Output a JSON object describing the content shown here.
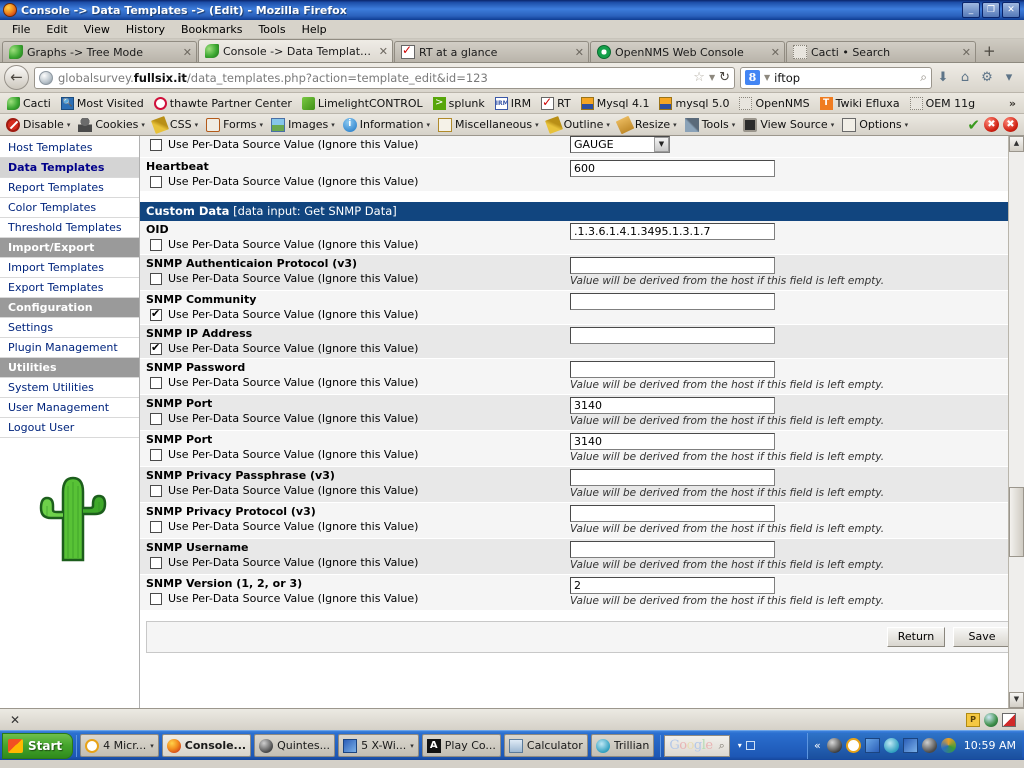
{
  "window": {
    "title": "Console -> Data Templates -> (Edit) - Mozilla Firefox",
    "app_icon": "firefox-icon",
    "minimize_label": "_",
    "maximize_label": "❐",
    "close_label": "✕"
  },
  "menubar": {
    "items": [
      {
        "label": "File"
      },
      {
        "label": "Edit"
      },
      {
        "label": "View"
      },
      {
        "label": "History"
      },
      {
        "label": "Bookmarks"
      },
      {
        "label": "Tools"
      },
      {
        "label": "Help"
      }
    ]
  },
  "tabs": {
    "items": [
      {
        "label": "Graphs -> Tree Mode",
        "icon": "firefox-leaf-icon",
        "active": false,
        "close": "✕"
      },
      {
        "label": "Console -> Data Templates -> ...",
        "icon": "firefox-leaf-icon",
        "active": true,
        "close": "✕"
      },
      {
        "label": "RT at a glance",
        "icon": "rt-check-icon",
        "active": false,
        "close": "✕"
      },
      {
        "label": "OpenNMS Web Console",
        "icon": "opennms-icon",
        "active": false,
        "close": "✕"
      },
      {
        "label": "Cacti • Search",
        "icon": "blank-page-icon",
        "active": false,
        "close": "✕"
      }
    ],
    "new_tab_label": "+"
  },
  "navbar": {
    "back_label": "←",
    "url_prefix": "globalsurvey.",
    "url_domain": "fullsix.it",
    "url_suffix": "/data_templates.php?action=template_edit&id=123",
    "star_label": "☆",
    "dropdown_label": "▼",
    "reload_label": "↻",
    "search_engine": "8",
    "search_query": "iftop",
    "magnifier_label": "⌕",
    "download_label": "⬇",
    "home_label": "⌂",
    "extra_label": "⚙",
    "overflow_label": "▾"
  },
  "bookmarks": {
    "items": [
      {
        "label": "Cacti",
        "icon": "cacti-icon"
      },
      {
        "label": "Most Visited",
        "icon": "most-visited-icon"
      },
      {
        "label": "thawte Partner Center",
        "icon": "thawte-icon"
      },
      {
        "label": "LimelightCONTROL",
        "icon": "limelight-icon"
      },
      {
        "label": "splunk",
        "icon": "splunk-icon"
      },
      {
        "label": "IRM",
        "icon": "irm-icon"
      },
      {
        "label": "RT",
        "icon": "rt-check-icon"
      },
      {
        "label": "Mysql 4.1",
        "icon": "phpmyadmin-icon"
      },
      {
        "label": "mysql 5.0",
        "icon": "phpmyadmin-icon"
      },
      {
        "label": "OpenNMS",
        "icon": "blank-page-icon"
      },
      {
        "label": "Twiki Efluxa",
        "icon": "twiki-icon"
      },
      {
        "label": "OEM 11g",
        "icon": "blank-page-icon"
      }
    ],
    "overflow_label": "»"
  },
  "devtoolbar": {
    "items": [
      {
        "label": "Disable",
        "icon": "disable-icon",
        "caret": "▾"
      },
      {
        "label": "Cookies",
        "icon": "cookies-icon",
        "caret": "▾"
      },
      {
        "label": "CSS",
        "icon": "css-icon",
        "caret": "▾"
      },
      {
        "label": "Forms",
        "icon": "forms-icon",
        "caret": "▾"
      },
      {
        "label": "Images",
        "icon": "images-icon",
        "caret": "▾"
      },
      {
        "label": "Information",
        "icon": "information-icon",
        "caret": "▾"
      },
      {
        "label": "Miscellaneous",
        "icon": "miscellaneous-icon",
        "caret": "▾"
      },
      {
        "label": "Outline",
        "icon": "outline-icon",
        "caret": "▾"
      },
      {
        "label": "Resize",
        "icon": "resize-icon",
        "caret": "▾"
      },
      {
        "label": "Tools",
        "icon": "tools-icon",
        "caret": "▾"
      },
      {
        "label": "View Source",
        "icon": "view-source-icon",
        "caret": "▾"
      },
      {
        "label": "Options",
        "icon": "options-icon",
        "caret": "▾"
      }
    ],
    "validation_ok": "✔",
    "error_badge_1": "✖",
    "error_badge_2": "✖"
  },
  "sidebar": {
    "items": [
      {
        "label": "Host Templates",
        "type": "link",
        "selected": false
      },
      {
        "label": "Data Templates",
        "type": "link",
        "selected": true
      },
      {
        "label": "Report Templates",
        "type": "link",
        "selected": false
      },
      {
        "label": "Color Templates",
        "type": "link",
        "selected": false
      },
      {
        "label": "Threshold Templates",
        "type": "link",
        "selected": false
      },
      {
        "label": "Import/Export",
        "type": "header",
        "selected": false
      },
      {
        "label": "Import Templates",
        "type": "link",
        "selected": false
      },
      {
        "label": "Export Templates",
        "type": "link",
        "selected": false
      },
      {
        "label": "Configuration",
        "type": "header",
        "selected": false
      },
      {
        "label": "Settings",
        "type": "link",
        "selected": false
      },
      {
        "label": "Plugin Management",
        "type": "link",
        "selected": false
      },
      {
        "label": "Utilities",
        "type": "header",
        "selected": false
      },
      {
        "label": "System Utilities",
        "type": "link",
        "selected": false
      },
      {
        "label": "User Management",
        "type": "link",
        "selected": false
      },
      {
        "label": "Logout User",
        "type": "link",
        "selected": false
      }
    ],
    "logo_alt": "cactus-logo"
  },
  "form": {
    "per_data_label": "Use Per-Data Source Value (Ignore this Value)",
    "derived_hint": "Value will be derived from the host if this field is left empty.",
    "partial_top_row": {
      "checkbox_checked": false,
      "select_value": "GAUGE"
    },
    "heartbeat_row": {
      "label": "Heartbeat",
      "checkbox_checked": false,
      "value": "600"
    },
    "section_header": {
      "title": "Custom Data",
      "subtitle": "[data input: Get SNMP Data]"
    },
    "fields": [
      {
        "label": "OID",
        "checked": false,
        "value": ".1.3.6.1.4.1.3495.1.3.1.7",
        "hint": false,
        "shade": false
      },
      {
        "label": "SNMP Authenticaion Protocol (v3)",
        "checked": false,
        "value": "",
        "hint": true,
        "shade": true
      },
      {
        "label": "SNMP Community",
        "checked": true,
        "value": "",
        "hint": false,
        "shade": false
      },
      {
        "label": "SNMP IP Address",
        "checked": true,
        "value": "",
        "hint": false,
        "shade": true
      },
      {
        "label": "SNMP Password",
        "checked": false,
        "value": "",
        "hint": true,
        "shade": false
      },
      {
        "label": "SNMP Port",
        "checked": false,
        "value": "3140",
        "hint": true,
        "shade": true
      },
      {
        "label": "SNMP Port",
        "checked": false,
        "value": "3140",
        "hint": true,
        "shade": false
      },
      {
        "label": "SNMP Privacy Passphrase (v3)",
        "checked": false,
        "value": "",
        "hint": true,
        "shade": true
      },
      {
        "label": "SNMP Privacy Protocol (v3)",
        "checked": false,
        "value": "",
        "hint": true,
        "shade": false
      },
      {
        "label": "SNMP Username",
        "checked": false,
        "value": "",
        "hint": true,
        "shade": true
      },
      {
        "label": "SNMP Version (1, 2, or 3)",
        "checked": false,
        "value": "2",
        "hint": true,
        "shade": false
      }
    ],
    "buttons": {
      "return_label": "Return",
      "save_label": "Save"
    }
  },
  "scrollbar": {
    "up_label": "▲",
    "down_label": "▼"
  },
  "statusbar": {
    "close_label": "✕",
    "icons": [
      "p-badge-icon",
      "globe-icon",
      "flag-icon"
    ]
  },
  "taskbar": {
    "start_label": "Start",
    "tasks": [
      {
        "label": "4 Micr...",
        "icon": "clock-icon",
        "active": false,
        "caret": "▾"
      },
      {
        "label": "Console...",
        "icon": "firefox-icon",
        "active": true,
        "caret": ""
      },
      {
        "label": "Quintes...",
        "icon": "quintessence-icon",
        "active": false,
        "caret": ""
      },
      {
        "label": "5 X-Wi...",
        "icon": "xwindow-icon",
        "active": false,
        "caret": "▾"
      },
      {
        "label": "Play Co...",
        "icon": "play-icon",
        "active": false,
        "caret": ""
      },
      {
        "label": "Calculator",
        "icon": "calculator-icon",
        "active": false,
        "caret": ""
      },
      {
        "label": "Trillian",
        "icon": "trillian-icon",
        "active": false,
        "caret": ""
      }
    ],
    "google_toolbar": {
      "logo": "Google",
      "magnifier": "⌕",
      "caret": "▾",
      "square": ""
    },
    "tray": {
      "expand_label": "«",
      "icons": [
        "quintessence-icon",
        "clock-icon",
        "network-icon",
        "trillian-icon",
        "xwindow-icon",
        "disc-icon",
        "opera-icon"
      ],
      "clock": "10:59 AM"
    }
  },
  "colors": {
    "titlebar_blue": "#1d4ea8",
    "section_header_blue": "#11457f",
    "sidebar_link": "#00247d",
    "sidebar_header_gray": "#9a9a9a",
    "taskbar_blue": "#2565c4",
    "start_green": "#46a62d"
  }
}
